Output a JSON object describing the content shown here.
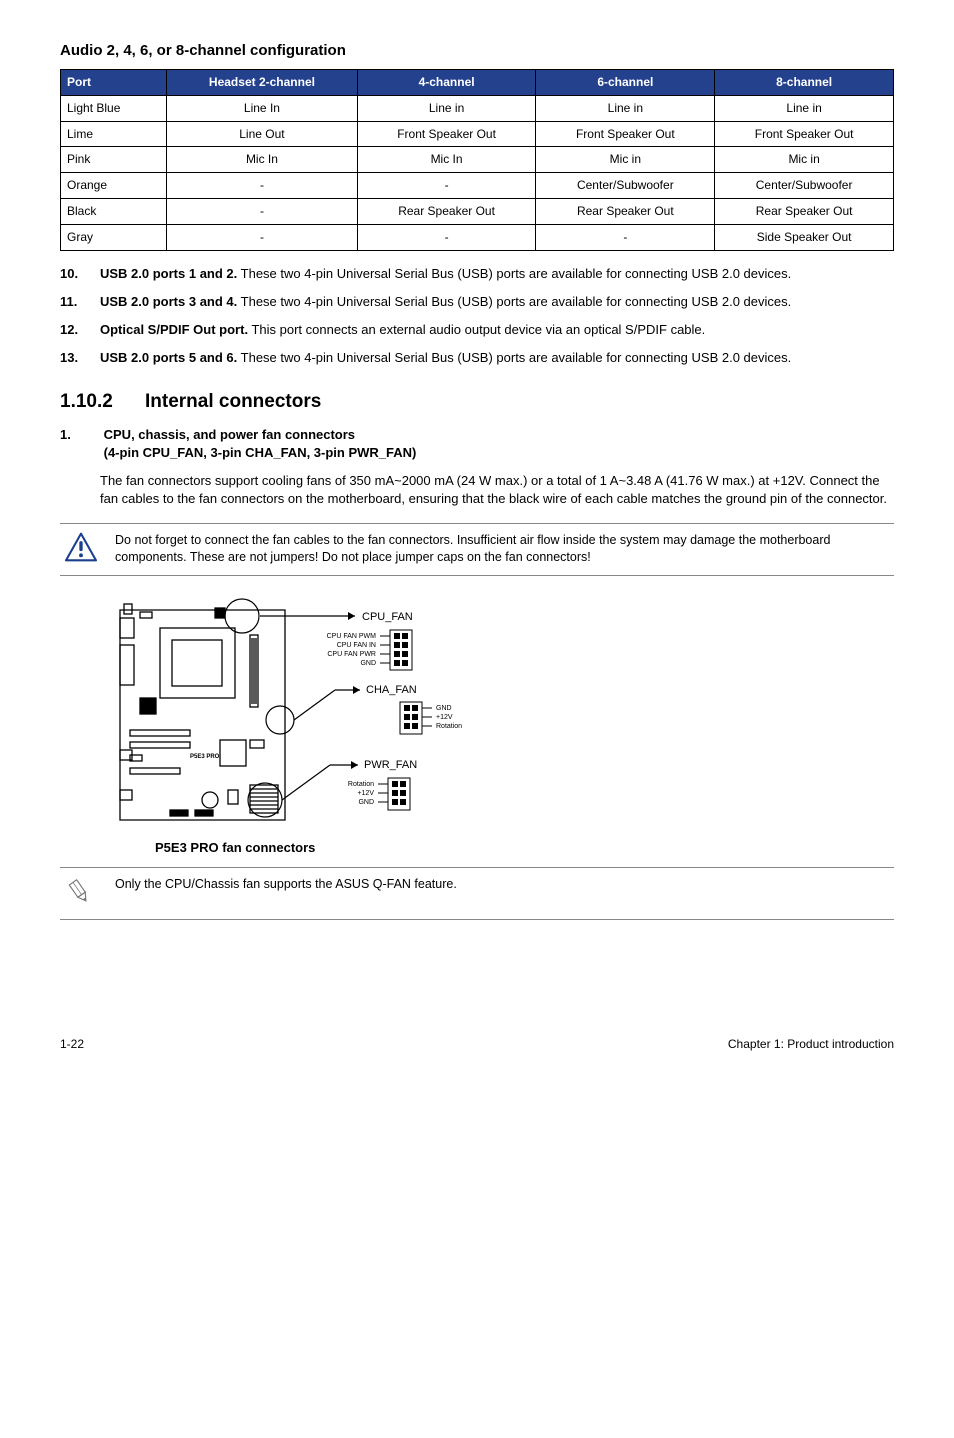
{
  "audio_heading": "Audio 2, 4, 6, or 8-channel configuration",
  "audio_table": {
    "headers": [
      "Port",
      "Headset 2-channel",
      "4-channel",
      "6-channel",
      "8-channel"
    ],
    "rows": [
      [
        "Light Blue",
        "Line In",
        "Line in",
        "Line in",
        "Line in"
      ],
      [
        "Lime",
        "Line Out",
        "Front Speaker Out",
        "Front Speaker Out",
        "Front Speaker Out"
      ],
      [
        "Pink",
        "Mic In",
        "Mic In",
        "Mic in",
        "Mic in"
      ],
      [
        "Orange",
        "-",
        "-",
        "Center/Subwoofer",
        "Center/Subwoofer"
      ],
      [
        "Black",
        "-",
        "Rear Speaker Out",
        "Rear Speaker Out",
        "Rear Speaker Out"
      ],
      [
        "Gray",
        "-",
        "-",
        "-",
        "Side Speaker Out"
      ]
    ]
  },
  "items": {
    "i10": {
      "num": "10.",
      "bold": "USB 2.0 ports 1 and 2.",
      "rest": " These two 4-pin Universal Serial Bus (USB) ports are available for connecting USB 2.0 devices."
    },
    "i11": {
      "num": "11.",
      "bold": "USB 2.0 ports 3 and 4.",
      "rest": " These two 4-pin Universal Serial Bus (USB) ports are available for connecting USB 2.0 devices."
    },
    "i12": {
      "num": "12.",
      "bold": "Optical S/PDIF Out port.",
      "rest": " This port connects an external audio output device via an optical S/PDIF cable."
    },
    "i13": {
      "num": "13.",
      "bold": "USB 2.0 ports 5 and 6.",
      "rest": " These two 4-pin Universal Serial Bus (USB) ports are available for connecting USB 2.0 devices."
    }
  },
  "section2": {
    "num": "1.10.2",
    "title": "Internal connectors",
    "sub1": {
      "num": "1.",
      "line1": "CPU, chassis, and power fan connectors",
      "line2": "(4-pin CPU_FAN, 3-pin CHA_FAN, 3-pin PWR_FAN)"
    },
    "para": "The fan connectors support cooling fans of 350 mA~2000 mA (24 W max.) or a total of 1 A~3.48 A (41.76 W max.) at +12V. Connect the fan cables to the fan connectors on the motherboard, ensuring that the black wire of each cable matches the ground pin of the connector."
  },
  "warn_text": "Do not forget to connect the fan cables to the fan connectors. Insufficient air flow inside the system may damage the motherboard components. These are not jumpers! Do not place jumper caps on the fan connectors!",
  "diagram": {
    "caption": "P5E3 PRO fan connectors",
    "labels": {
      "cpu_fan": "CPU_FAN",
      "cha_fan": "CHA_FAN",
      "pwr_fan": "PWR_FAN",
      "cpu_pwm": "CPU FAN PWM",
      "cpu_in": "CPU FAN IN",
      "cpu_pwr": "CPU FAN PWR",
      "gnd": "GND",
      "p12v": "+12V",
      "rotation": "Rotation",
      "board": "P5E3 PRO"
    }
  },
  "note_text": "Only the CPU/Chassis fan supports the ASUS Q-FAN feature.",
  "footer": {
    "left": "1-22",
    "right": "Chapter 1: Product introduction"
  }
}
